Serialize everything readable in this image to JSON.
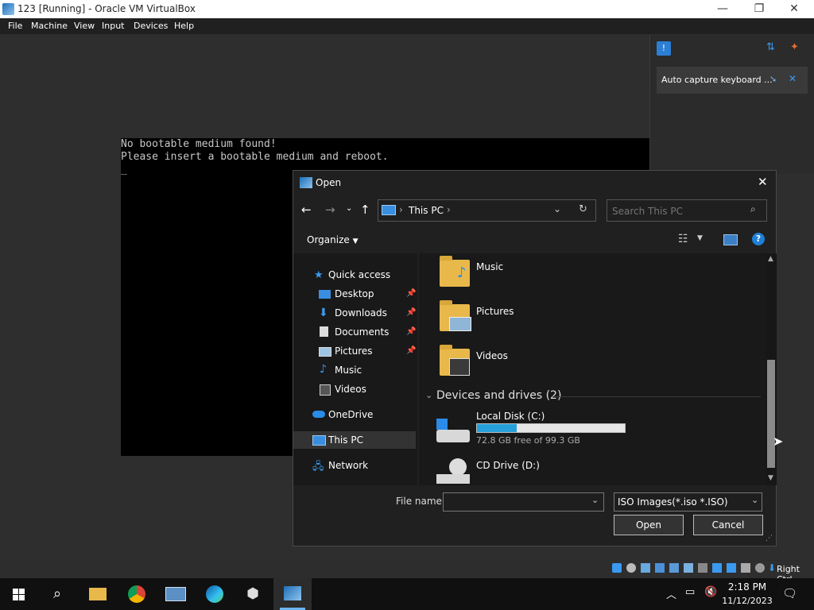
{
  "window": {
    "title": "123 [Running] - Oracle VM VirtualBox",
    "minimize": "—",
    "restore": "❐",
    "close": "✕"
  },
  "menubar": [
    "File",
    "Machine",
    "View",
    "Input",
    "Devices",
    "Help"
  ],
  "console": {
    "line1": "No bootable medium found!",
    "line2": "Please insert a bootable medium and reboot.",
    "cursor": "_"
  },
  "notification": {
    "message": "Auto capture keyboard ..."
  },
  "dialog": {
    "title": "Open",
    "close": "✕",
    "address": "This PC",
    "search_placeholder": "Search This PC",
    "organize": "Organize",
    "nav": {
      "quick_access": "Quick access",
      "items": [
        "Desktop",
        "Downloads",
        "Documents",
        "Pictures",
        "Music",
        "Videos"
      ],
      "onedrive": "OneDrive",
      "this_pc": "This PC",
      "network": "Network"
    },
    "folders": [
      "Music",
      "Pictures",
      "Videos"
    ],
    "devices_header": "Devices and drives (2)",
    "drives": [
      {
        "name": "Local Disk (C:)",
        "free": "72.8 GB free of 99.3 GB",
        "used_fraction": 0.27
      },
      {
        "name": "CD Drive (D:)"
      }
    ],
    "filename_label": "File name:",
    "filename_value": "",
    "filter": "ISO Images(*.iso *.ISO)",
    "open_button": "Open",
    "cancel_button": "Cancel"
  },
  "vm_tray": {
    "host_key": "Right Ctrl"
  },
  "taskbar": {
    "time": "2:18 PM",
    "date": "11/12/2023"
  },
  "colors": {
    "accent": "#1e90d8",
    "folder": "#e8b84a",
    "dialog_bg": "#202020"
  }
}
